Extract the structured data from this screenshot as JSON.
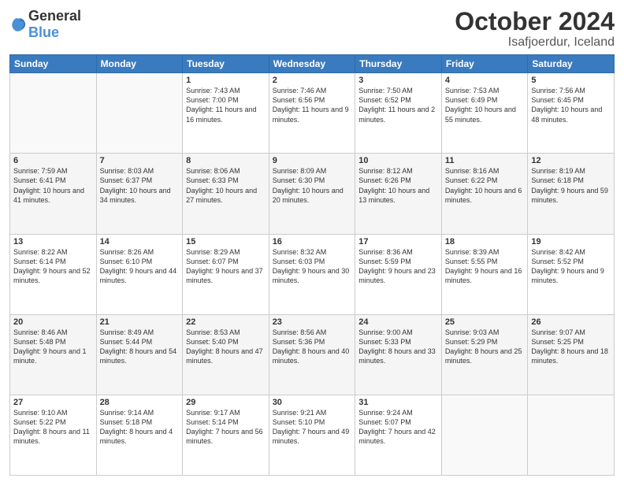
{
  "logo": {
    "general": "General",
    "blue": "Blue"
  },
  "header": {
    "month": "October 2024",
    "location": "Isafjoerdur, Iceland"
  },
  "weekdays": [
    "Sunday",
    "Monday",
    "Tuesday",
    "Wednesday",
    "Thursday",
    "Friday",
    "Saturday"
  ],
  "weeks": [
    [
      {
        "day": "",
        "sunrise": "",
        "sunset": "",
        "daylight": ""
      },
      {
        "day": "",
        "sunrise": "",
        "sunset": "",
        "daylight": ""
      },
      {
        "day": "1",
        "sunrise": "Sunrise: 7:43 AM",
        "sunset": "Sunset: 7:00 PM",
        "daylight": "Daylight: 11 hours and 16 minutes."
      },
      {
        "day": "2",
        "sunrise": "Sunrise: 7:46 AM",
        "sunset": "Sunset: 6:56 PM",
        "daylight": "Daylight: 11 hours and 9 minutes."
      },
      {
        "day": "3",
        "sunrise": "Sunrise: 7:50 AM",
        "sunset": "Sunset: 6:52 PM",
        "daylight": "Daylight: 11 hours and 2 minutes."
      },
      {
        "day": "4",
        "sunrise": "Sunrise: 7:53 AM",
        "sunset": "Sunset: 6:49 PM",
        "daylight": "Daylight: 10 hours and 55 minutes."
      },
      {
        "day": "5",
        "sunrise": "Sunrise: 7:56 AM",
        "sunset": "Sunset: 6:45 PM",
        "daylight": "Daylight: 10 hours and 48 minutes."
      }
    ],
    [
      {
        "day": "6",
        "sunrise": "Sunrise: 7:59 AM",
        "sunset": "Sunset: 6:41 PM",
        "daylight": "Daylight: 10 hours and 41 minutes."
      },
      {
        "day": "7",
        "sunrise": "Sunrise: 8:03 AM",
        "sunset": "Sunset: 6:37 PM",
        "daylight": "Daylight: 10 hours and 34 minutes."
      },
      {
        "day": "8",
        "sunrise": "Sunrise: 8:06 AM",
        "sunset": "Sunset: 6:33 PM",
        "daylight": "Daylight: 10 hours and 27 minutes."
      },
      {
        "day": "9",
        "sunrise": "Sunrise: 8:09 AM",
        "sunset": "Sunset: 6:30 PM",
        "daylight": "Daylight: 10 hours and 20 minutes."
      },
      {
        "day": "10",
        "sunrise": "Sunrise: 8:12 AM",
        "sunset": "Sunset: 6:26 PM",
        "daylight": "Daylight: 10 hours and 13 minutes."
      },
      {
        "day": "11",
        "sunrise": "Sunrise: 8:16 AM",
        "sunset": "Sunset: 6:22 PM",
        "daylight": "Daylight: 10 hours and 6 minutes."
      },
      {
        "day": "12",
        "sunrise": "Sunrise: 8:19 AM",
        "sunset": "Sunset: 6:18 PM",
        "daylight": "Daylight: 9 hours and 59 minutes."
      }
    ],
    [
      {
        "day": "13",
        "sunrise": "Sunrise: 8:22 AM",
        "sunset": "Sunset: 6:14 PM",
        "daylight": "Daylight: 9 hours and 52 minutes."
      },
      {
        "day": "14",
        "sunrise": "Sunrise: 8:26 AM",
        "sunset": "Sunset: 6:10 PM",
        "daylight": "Daylight: 9 hours and 44 minutes."
      },
      {
        "day": "15",
        "sunrise": "Sunrise: 8:29 AM",
        "sunset": "Sunset: 6:07 PM",
        "daylight": "Daylight: 9 hours and 37 minutes."
      },
      {
        "day": "16",
        "sunrise": "Sunrise: 8:32 AM",
        "sunset": "Sunset: 6:03 PM",
        "daylight": "Daylight: 9 hours and 30 minutes."
      },
      {
        "day": "17",
        "sunrise": "Sunrise: 8:36 AM",
        "sunset": "Sunset: 5:59 PM",
        "daylight": "Daylight: 9 hours and 23 minutes."
      },
      {
        "day": "18",
        "sunrise": "Sunrise: 8:39 AM",
        "sunset": "Sunset: 5:55 PM",
        "daylight": "Daylight: 9 hours and 16 minutes."
      },
      {
        "day": "19",
        "sunrise": "Sunrise: 8:42 AM",
        "sunset": "Sunset: 5:52 PM",
        "daylight": "Daylight: 9 hours and 9 minutes."
      }
    ],
    [
      {
        "day": "20",
        "sunrise": "Sunrise: 8:46 AM",
        "sunset": "Sunset: 5:48 PM",
        "daylight": "Daylight: 9 hours and 1 minute."
      },
      {
        "day": "21",
        "sunrise": "Sunrise: 8:49 AM",
        "sunset": "Sunset: 5:44 PM",
        "daylight": "Daylight: 8 hours and 54 minutes."
      },
      {
        "day": "22",
        "sunrise": "Sunrise: 8:53 AM",
        "sunset": "Sunset: 5:40 PM",
        "daylight": "Daylight: 8 hours and 47 minutes."
      },
      {
        "day": "23",
        "sunrise": "Sunrise: 8:56 AM",
        "sunset": "Sunset: 5:36 PM",
        "daylight": "Daylight: 8 hours and 40 minutes."
      },
      {
        "day": "24",
        "sunrise": "Sunrise: 9:00 AM",
        "sunset": "Sunset: 5:33 PM",
        "daylight": "Daylight: 8 hours and 33 minutes."
      },
      {
        "day": "25",
        "sunrise": "Sunrise: 9:03 AM",
        "sunset": "Sunset: 5:29 PM",
        "daylight": "Daylight: 8 hours and 25 minutes."
      },
      {
        "day": "26",
        "sunrise": "Sunrise: 9:07 AM",
        "sunset": "Sunset: 5:25 PM",
        "daylight": "Daylight: 8 hours and 18 minutes."
      }
    ],
    [
      {
        "day": "27",
        "sunrise": "Sunrise: 9:10 AM",
        "sunset": "Sunset: 5:22 PM",
        "daylight": "Daylight: 8 hours and 11 minutes."
      },
      {
        "day": "28",
        "sunrise": "Sunrise: 9:14 AM",
        "sunset": "Sunset: 5:18 PM",
        "daylight": "Daylight: 8 hours and 4 minutes."
      },
      {
        "day": "29",
        "sunrise": "Sunrise: 9:17 AM",
        "sunset": "Sunset: 5:14 PM",
        "daylight": "Daylight: 7 hours and 56 minutes."
      },
      {
        "day": "30",
        "sunrise": "Sunrise: 9:21 AM",
        "sunset": "Sunset: 5:10 PM",
        "daylight": "Daylight: 7 hours and 49 minutes."
      },
      {
        "day": "31",
        "sunrise": "Sunrise: 9:24 AM",
        "sunset": "Sunset: 5:07 PM",
        "daylight": "Daylight: 7 hours and 42 minutes."
      },
      {
        "day": "",
        "sunrise": "",
        "sunset": "",
        "daylight": ""
      },
      {
        "day": "",
        "sunrise": "",
        "sunset": "",
        "daylight": ""
      }
    ]
  ]
}
